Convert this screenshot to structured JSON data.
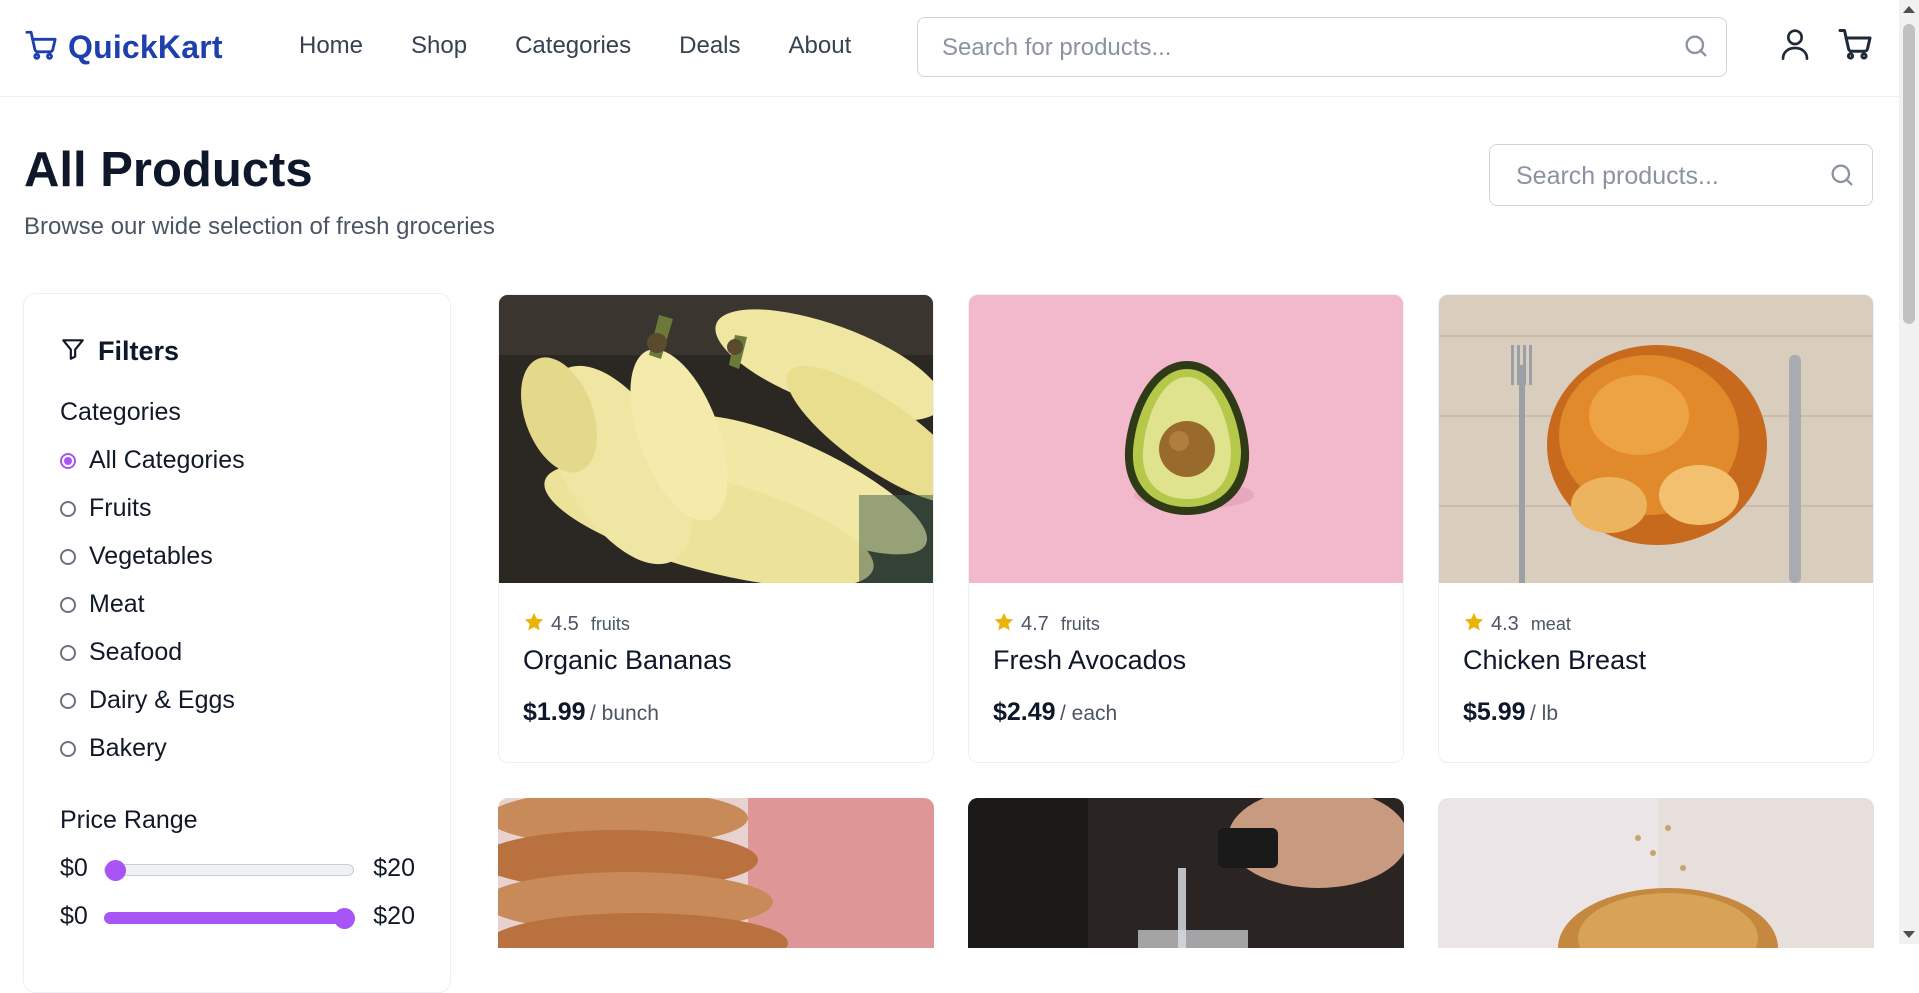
{
  "header": {
    "brand": "QuickKart",
    "nav": [
      "Home",
      "Shop",
      "Categories",
      "Deals",
      "About"
    ],
    "search_placeholder": "Search for products..."
  },
  "page": {
    "title": "All Products",
    "subtitle": "Browse our wide selection of fresh groceries",
    "search_placeholder": "Search products..."
  },
  "filters": {
    "title": "Filters",
    "categories_label": "Categories",
    "categories": [
      {
        "label": "All Categories",
        "checked": true
      },
      {
        "label": "Fruits",
        "checked": false
      },
      {
        "label": "Vegetables",
        "checked": false
      },
      {
        "label": "Meat",
        "checked": false
      },
      {
        "label": "Seafood",
        "checked": false
      },
      {
        "label": "Dairy & Eggs",
        "checked": false
      },
      {
        "label": "Bakery",
        "checked": false
      }
    ],
    "price_label": "Price Range",
    "min_slider": {
      "low": "$0",
      "high": "$20",
      "value_fraction": 0.0
    },
    "max_slider": {
      "low": "$0",
      "high": "$20",
      "value_fraction": 1.0
    }
  },
  "products": [
    {
      "name": "Organic Bananas",
      "rating": "4.5",
      "category": "fruits",
      "price": "$1.99",
      "unit": "/ bunch"
    },
    {
      "name": "Fresh Avocados",
      "rating": "4.7",
      "category": "fruits",
      "price": "$2.49",
      "unit": "/ each"
    },
    {
      "name": "Chicken Breast",
      "rating": "4.3",
      "category": "meat",
      "price": "$5.99",
      "unit": "/ lb"
    }
  ],
  "colors": {
    "brand": "#1e40af",
    "accent": "#a855f7",
    "star": "#eab308"
  }
}
